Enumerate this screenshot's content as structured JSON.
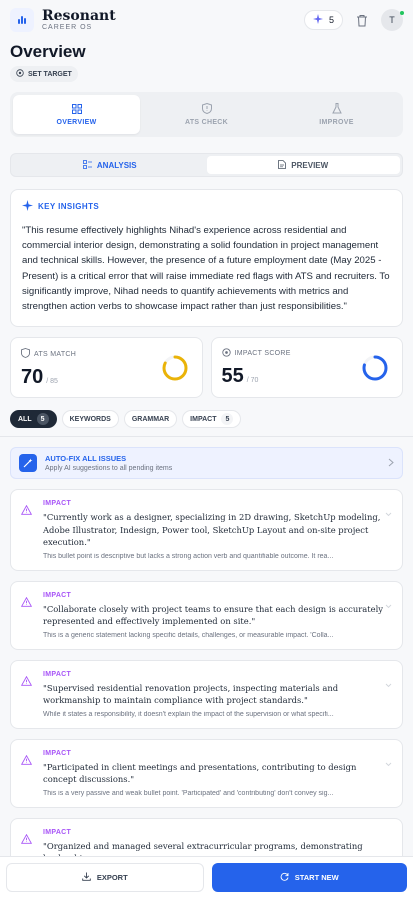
{
  "brand": {
    "name": "Resonant",
    "subtitle": "CAREER OS"
  },
  "header": {
    "credits": "5",
    "avatar": "T"
  },
  "page": {
    "title": "Overview",
    "set_target": "SET TARGET"
  },
  "tabs": [
    {
      "label": "OVERVIEW",
      "icon": "grid-icon"
    },
    {
      "label": "ATS CHECK",
      "icon": "shield-icon"
    },
    {
      "label": "IMPROVE",
      "icon": "flask-icon"
    }
  ],
  "subtabs": {
    "analysis": "ANALYSIS",
    "preview": "PREVIEW"
  },
  "insights": {
    "heading": "KEY INSIGHTS",
    "text": "\"This resume effectively highlights Nihad's experience across residential and commercial interior design, demonstrating a solid foundation in project management and technical skills. However, the presence of a future employment date (May 2025 - Present) is a critical error that will raise immediate red flags with ATS and recruiters. To significantly improve, Nihad needs to quantify achievements with metrics and strengthen action verbs to showcase impact rather than just responsibilities.\""
  },
  "metrics": {
    "ats": {
      "label": "ATS MATCH",
      "value": "70",
      "of": "/ 85",
      "ratio": 0.82,
      "color": "#eab308"
    },
    "impact": {
      "label": "IMPACT SCORE",
      "value": "55",
      "of": "/ 70",
      "ratio": 0.79,
      "color": "#2563eb"
    }
  },
  "filters": [
    {
      "label": "ALL",
      "count": "5",
      "active": true
    },
    {
      "label": "KEYWORDS",
      "count": "",
      "active": false
    },
    {
      "label": "GRAMMAR",
      "count": "",
      "active": false
    },
    {
      "label": "IMPACT",
      "count": "5",
      "active": false
    }
  ],
  "autofix": {
    "title": "AUTO-FIX ALL ISSUES",
    "subtitle": "Apply AI suggestions to all pending items"
  },
  "issues": [
    {
      "tag": "IMPACT",
      "quote": "\"Currently work as a designer, specializing in 2D drawing, SketchUp modeling, Adobe Illustrator, Indesign, Power tool, SketchUp Layout and on-site project execution.\"",
      "desc": "This bullet point is descriptive but lacks a strong action verb and quantifiable outcome. It rea..."
    },
    {
      "tag": "IMPACT",
      "quote": "\"Collaborate closely with project teams to ensure that each design is accurately represented and effectively implemented on site.\"",
      "desc": "This is a generic statement lacking specific details, challenges, or measurable impact. 'Colla..."
    },
    {
      "tag": "IMPACT",
      "quote": "\"Supervised residential renovation projects, inspecting materials and workmanship to maintain compliance with project standards.\"",
      "desc": "While it states a responsibility, it doesn't explain the impact of the supervision or what specifi..."
    },
    {
      "tag": "IMPACT",
      "quote": "\"Participated in client meetings and presentations, contributing to design concept discussions.\"",
      "desc": "This is a very passive and weak bullet point. 'Participated' and 'contributing' don't convey sig..."
    },
    {
      "tag": "IMPACT",
      "quote": "\"Organized and managed several extracurricular programs, demonstrating leadership",
      "desc": ""
    }
  ],
  "bottom": {
    "export": "EXPORT",
    "start": "START NEW"
  }
}
